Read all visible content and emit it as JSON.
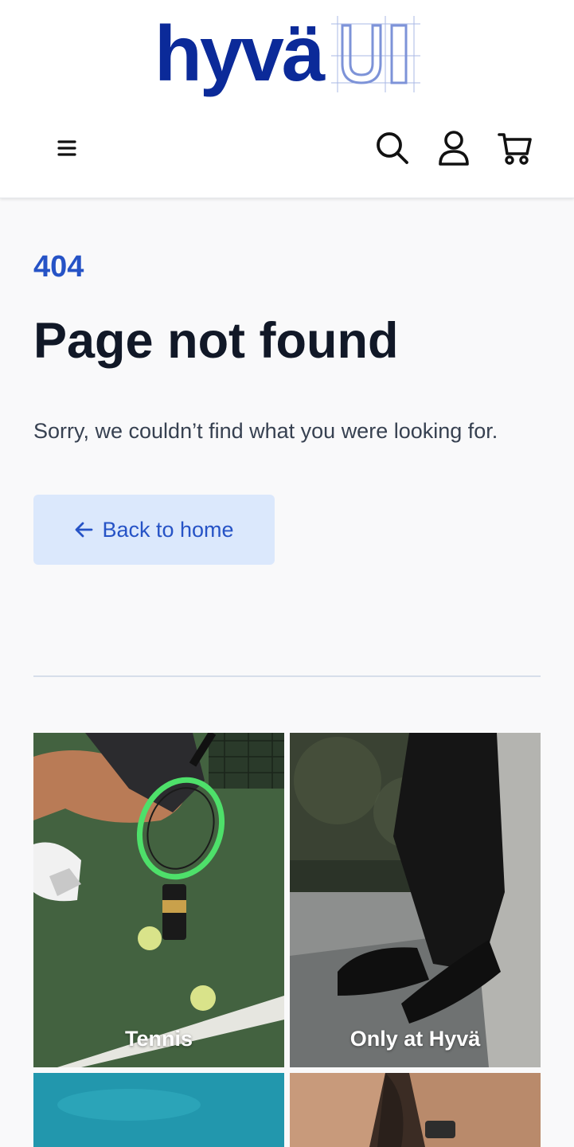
{
  "header": {
    "logo_text": "hyvä",
    "logo_mark_text": "UI",
    "icons": [
      "menu-icon",
      "search-icon",
      "account-icon",
      "cart-icon"
    ]
  },
  "error": {
    "code": "404",
    "title": "Page not found",
    "message": "Sorry, we couldn’t find what you were looking for.",
    "back_label": "Back to home"
  },
  "categories": [
    {
      "label": "Tennis"
    },
    {
      "label": "Only at Hyvä"
    },
    {
      "label": ""
    },
    {
      "label": ""
    }
  ],
  "colors": {
    "brand": "#0b2a99",
    "accent": "#2653c6",
    "button_bg": "#dbe8fc",
    "page_bg": "#f9f9fa"
  }
}
